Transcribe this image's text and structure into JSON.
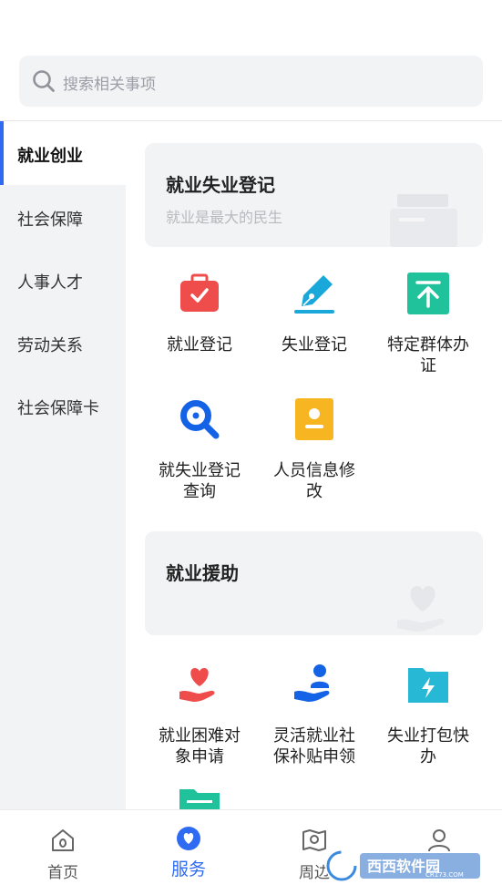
{
  "search": {
    "placeholder": "搜索相关事项"
  },
  "sidebar": {
    "items": [
      {
        "label": "就业创业",
        "active": true
      },
      {
        "label": "社会保障"
      },
      {
        "label": "人事人才"
      },
      {
        "label": "劳动关系"
      },
      {
        "label": "社会保障卡"
      }
    ]
  },
  "sections": [
    {
      "title": "就业失业登记",
      "subtitle": "就业是最大的民生",
      "services": [
        {
          "label": "就业登记",
          "icon": "briefcase-check-icon",
          "color": "#ef4c4c"
        },
        {
          "label": "失业登记",
          "icon": "pen-sign-icon",
          "color": "#1aa7d9"
        },
        {
          "label": "特定群体办证",
          "icon": "upload-arrow-icon",
          "color": "#1fc29a"
        },
        {
          "label": "就失业登记查询",
          "icon": "magnifier-icon",
          "color": "#1463e6"
        },
        {
          "label": "人员信息修改",
          "icon": "id-card-icon",
          "color": "#f7b521"
        }
      ]
    },
    {
      "title": "就业援助",
      "subtitle": "",
      "services": [
        {
          "label": "就业困难对象申请",
          "icon": "heart-hand-icon",
          "color": "#ef4c4c"
        },
        {
          "label": "灵活就业社保补贴申领",
          "icon": "person-hand-icon",
          "color": "#1463e6"
        },
        {
          "label": "失业打包快办",
          "icon": "folder-bolt-icon",
          "color": "#27b8d6"
        }
      ]
    }
  ],
  "tabbar": {
    "tabs": [
      {
        "label": "首页",
        "icon": "home-icon"
      },
      {
        "label": "服务",
        "icon": "heart-service-icon",
        "active": true
      },
      {
        "label": "周边",
        "icon": "map-pin-icon"
      },
      {
        "label": "",
        "icon": "user-icon"
      }
    ]
  },
  "watermark": {
    "brand": "西西软件园",
    "url": "CR173.COM"
  },
  "colors": {
    "accent": "#2f6bf2",
    "panel": "#f2f3f5"
  }
}
